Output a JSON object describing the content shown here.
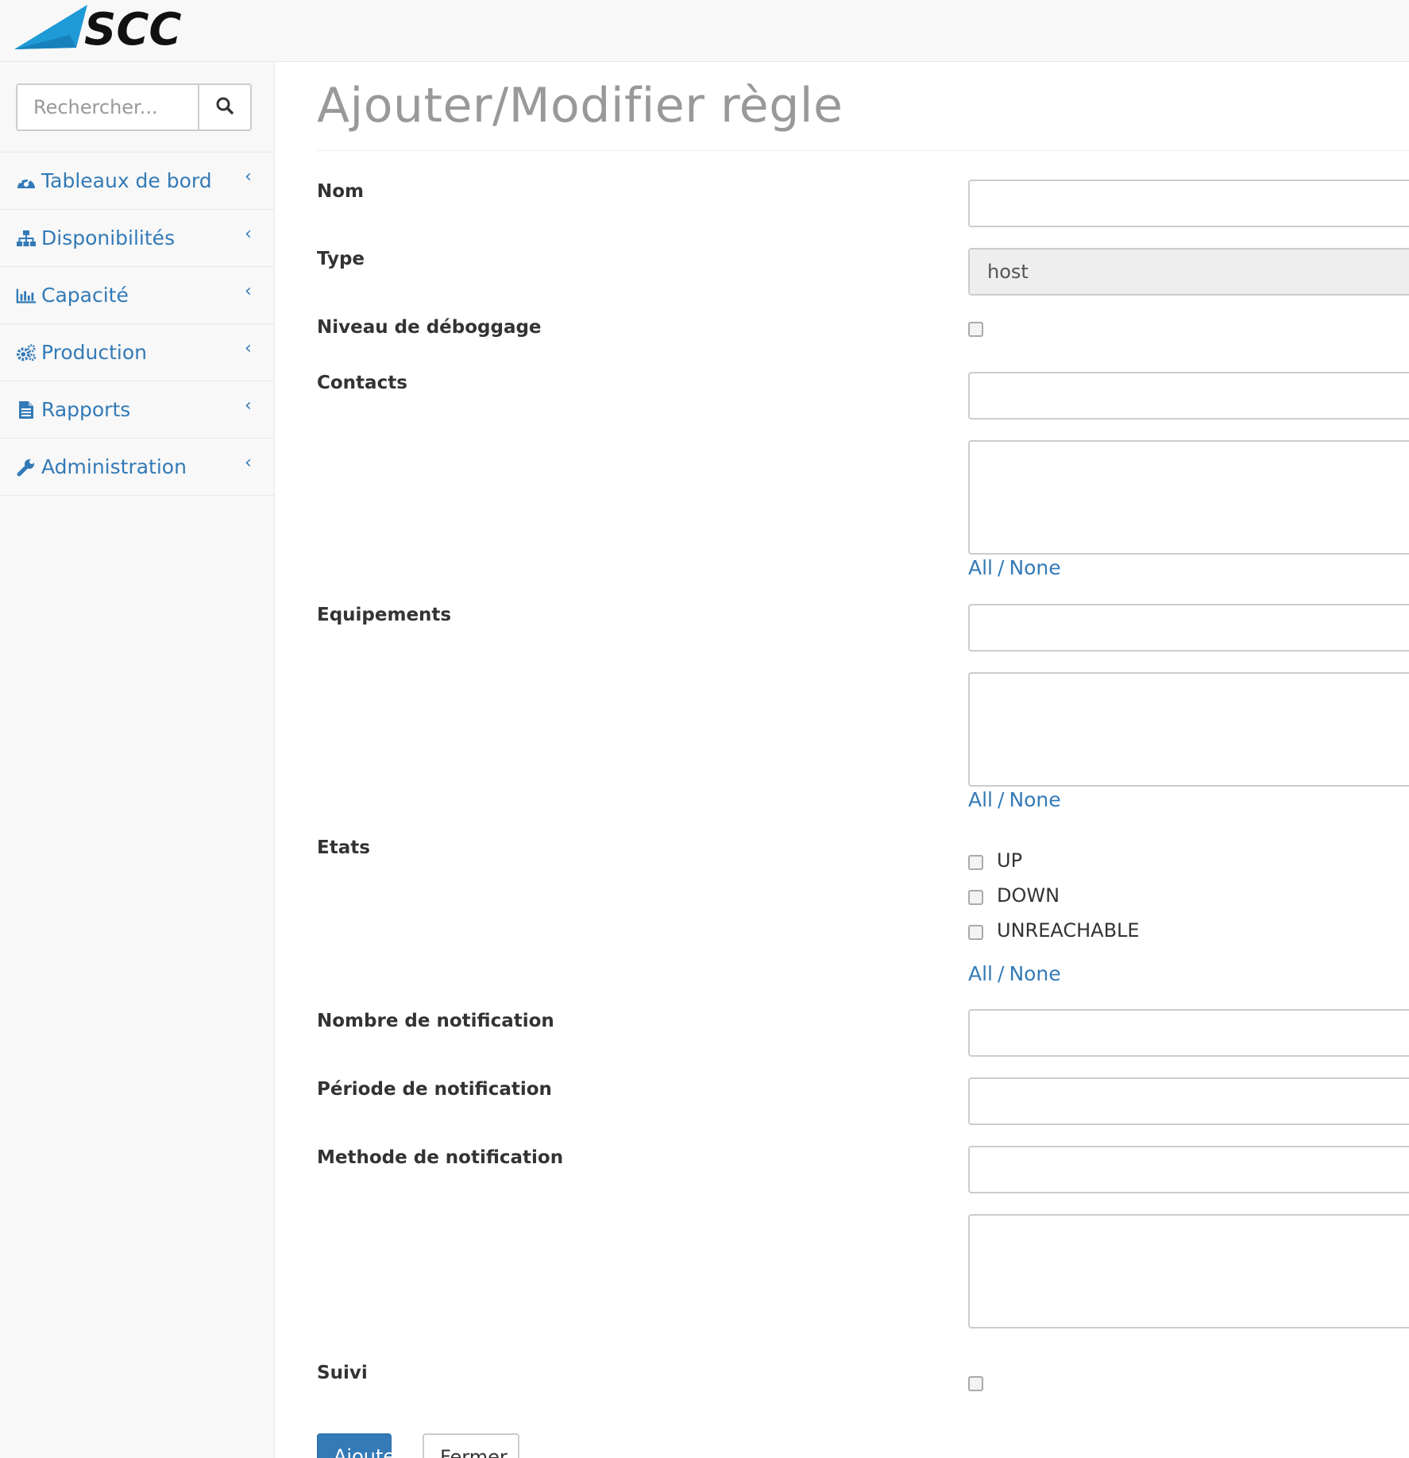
{
  "logo": {
    "text": "SCC",
    "accent_color": "#1e9ad6"
  },
  "sidebar": {
    "search": {
      "placeholder": "Rechercher...",
      "icon": "search-icon"
    },
    "items": [
      {
        "label": "Tableaux de bord",
        "icon": "dashboard-icon"
      },
      {
        "label": "Disponibilités",
        "icon": "sitemap-icon"
      },
      {
        "label": "Capacité",
        "icon": "bar-chart-icon"
      },
      {
        "label": "Production",
        "icon": "cogs-icon"
      },
      {
        "label": "Rapports",
        "icon": "file-text-icon"
      },
      {
        "label": "Administration",
        "icon": "wrench-icon"
      }
    ],
    "chevron": "‹"
  },
  "form": {
    "title": "Ajouter/Modifier règle",
    "nom": {
      "label": "Nom",
      "value": ""
    },
    "type": {
      "label": "Type",
      "value": "host"
    },
    "debug": {
      "label": "Niveau de déboggage",
      "checked": false
    },
    "contacts": {
      "label": "Contacts",
      "all": "All",
      "sep": "/",
      "none": "None"
    },
    "equipements": {
      "label": "Equipements",
      "all": "All",
      "sep": "/",
      "none": "None"
    },
    "etats": {
      "label": "Etats",
      "options": [
        {
          "label": "UP",
          "checked": false
        },
        {
          "label": "DOWN",
          "checked": false
        },
        {
          "label": "UNREACHABLE",
          "checked": false
        }
      ],
      "all": "All",
      "sep": "/",
      "none": "None"
    },
    "nombre": {
      "label": "Nombre de notification",
      "value": ""
    },
    "periode": {
      "label": "Période de notification",
      "value": ""
    },
    "methode": {
      "label": "Methode de notification",
      "value": ""
    },
    "suivi": {
      "label": "Suivi",
      "checked": false
    },
    "buttons": {
      "submit": "Ajouter",
      "close": "Fermer"
    }
  },
  "colors": {
    "link": "#337ab7",
    "primary": "#337ab7",
    "sidebar_bg": "#f8f8f8"
  }
}
